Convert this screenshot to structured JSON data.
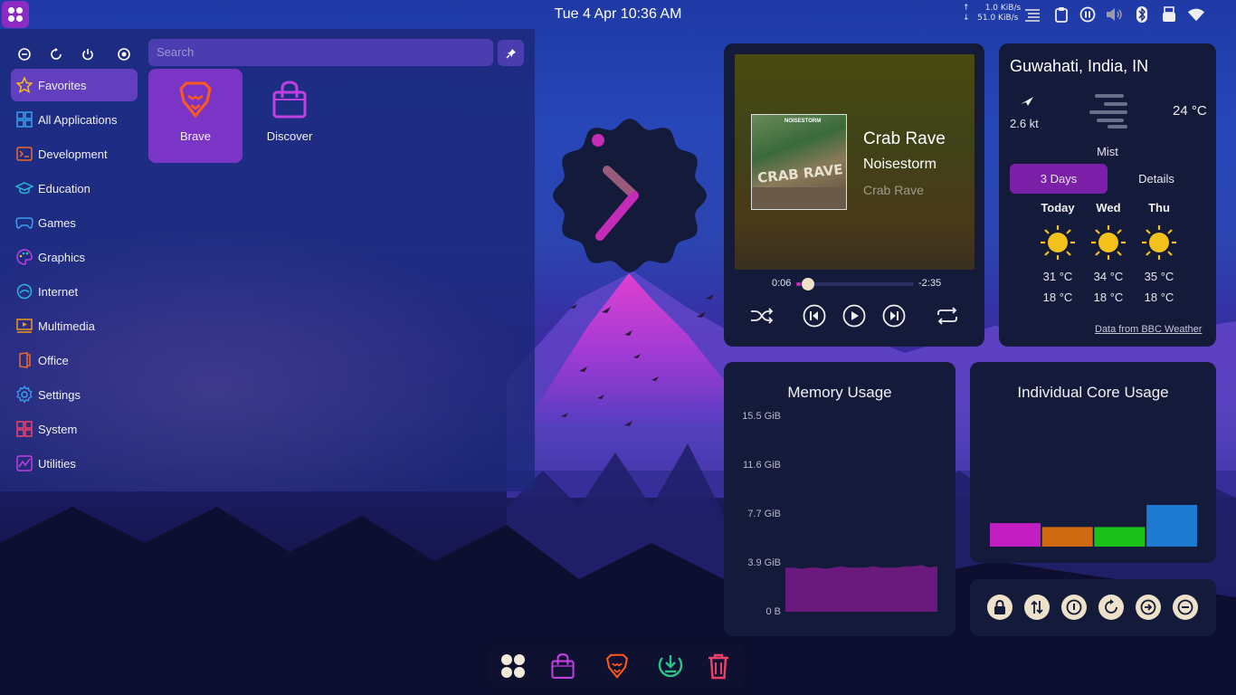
{
  "topbar": {
    "datetime": "Tue 4 Apr  10:36 AM",
    "net_up": "1.0 KiB/s",
    "net_down": "51.0 KiB/s",
    "icons": [
      "launcher-icon",
      "clipboard-list-icon",
      "clipboard-icon",
      "media-pause-icon",
      "volume-icon",
      "bluetooth-icon",
      "usb-drive-icon",
      "wifi-icon"
    ]
  },
  "menu": {
    "power_icons": [
      "logout-icon",
      "restart-icon",
      "shutdown-icon",
      "sleep-icon"
    ],
    "search_placeholder": "Search",
    "categories": [
      {
        "label": "Favorites",
        "icon": "star-icon"
      },
      {
        "label": "All Applications",
        "icon": "grid-icon"
      },
      {
        "label": "Development",
        "icon": "terminal-icon"
      },
      {
        "label": "Education",
        "icon": "graduation-cap-icon"
      },
      {
        "label": "Games",
        "icon": "gamepad-icon"
      },
      {
        "label": "Graphics",
        "icon": "palette-icon"
      },
      {
        "label": "Internet",
        "icon": "globe-icon"
      },
      {
        "label": "Multimedia",
        "icon": "multimedia-icon"
      },
      {
        "label": "Office",
        "icon": "office-icon"
      },
      {
        "label": "Settings",
        "icon": "gear-icon"
      },
      {
        "label": "System",
        "icon": "system-icon"
      },
      {
        "label": "Utilities",
        "icon": "utilities-icon"
      }
    ],
    "apps": [
      {
        "label": "Brave",
        "icon": "brave-lion-icon"
      },
      {
        "label": "Discover",
        "icon": "shopping-bag-icon"
      }
    ]
  },
  "player": {
    "cover_text": "CRAB RAVE",
    "cover_brand": "NOISESTORM",
    "title": "Crab Rave",
    "artist": "Noisestorm",
    "album": "Crab Rave",
    "elapsed": "0:06",
    "remaining": "-2:35",
    "progress": 0.04
  },
  "weather": {
    "city": "Guwahati, India, IN",
    "wind": "2.6 kt",
    "temp": "24 °C",
    "condition": "Mist",
    "tab_days": "3 Days",
    "tab_details": "Details",
    "days": [
      {
        "name": "Today",
        "high": "31 °C",
        "low": "18 °C"
      },
      {
        "name": "Wed",
        "high": "34 °C",
        "low": "18 °C"
      },
      {
        "name": "Thu",
        "high": "35 °C",
        "low": "18 °C"
      }
    ],
    "credit": "Data from BBC Weather"
  },
  "memory": {
    "title": "Memory Usage",
    "y_ticks": [
      "15.5 GiB",
      "11.6 GiB",
      "7.7 GiB",
      "3.9 GiB",
      "0 B"
    ]
  },
  "cores": {
    "title": "Individual Core Usage"
  },
  "chart_data": [
    {
      "type": "area",
      "title": "Memory Usage",
      "ylim": [
        0,
        15.5
      ],
      "y_ticks": [
        "15.5 GiB",
        "11.6 GiB",
        "7.7 GiB",
        "3.9 GiB",
        "0 B"
      ],
      "series": [
        {
          "values": [
            3.5,
            3.5,
            3.4,
            3.5,
            3.5,
            3.4,
            3.5,
            3.6,
            3.5,
            3.5,
            3.5,
            3.6,
            3.5,
            3.5,
            3.5,
            3.6,
            3.6,
            3.7,
            3.5,
            3.6
          ]
        }
      ],
      "color": "#6a1a7c"
    },
    {
      "type": "bar",
      "title": "Individual Core Usage",
      "values": [
        18,
        15,
        15,
        32
      ],
      "colors": [
        "#c21ec2",
        "#d06a10",
        "#1ac21a",
        "#1e7ad0"
      ]
    }
  ],
  "sys_buttons": [
    "lock-icon",
    "switch-user-icon",
    "shutdown-icon",
    "restart-icon",
    "logout-icon",
    "sleep-icon"
  ],
  "dock": [
    "app-launcher-icon",
    "discover-bag-icon",
    "brave-lion-icon",
    "download-icon",
    "trash-icon"
  ]
}
